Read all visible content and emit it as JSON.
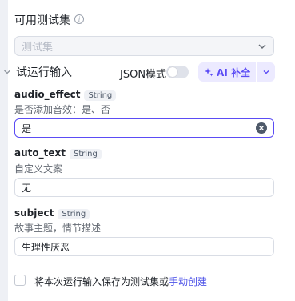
{
  "testset": {
    "title": "可用测试集",
    "placeholder": "测试集"
  },
  "run_input": {
    "label": "试运行输入",
    "json_mode_label": "JSON模式",
    "json_mode_on": false,
    "ai_button_label": "AI 补全"
  },
  "fields": [
    {
      "name": "audio_effect",
      "type": "String",
      "description": "是否添加音效：是、否",
      "value": "是"
    },
    {
      "name": "auto_text",
      "type": "String",
      "description": "自定义文案",
      "value": "无"
    },
    {
      "name": "subject",
      "type": "String",
      "description": "故事主题，情节描述",
      "value": "生理性厌恶"
    }
  ],
  "footer": {
    "save_text": "将本次运行输入保存为测试集或",
    "manual_create_link": "手动创建"
  },
  "colors": {
    "accent": "#5b4cf5",
    "link": "#4d53e8",
    "ai_bg": "#eceaff"
  }
}
